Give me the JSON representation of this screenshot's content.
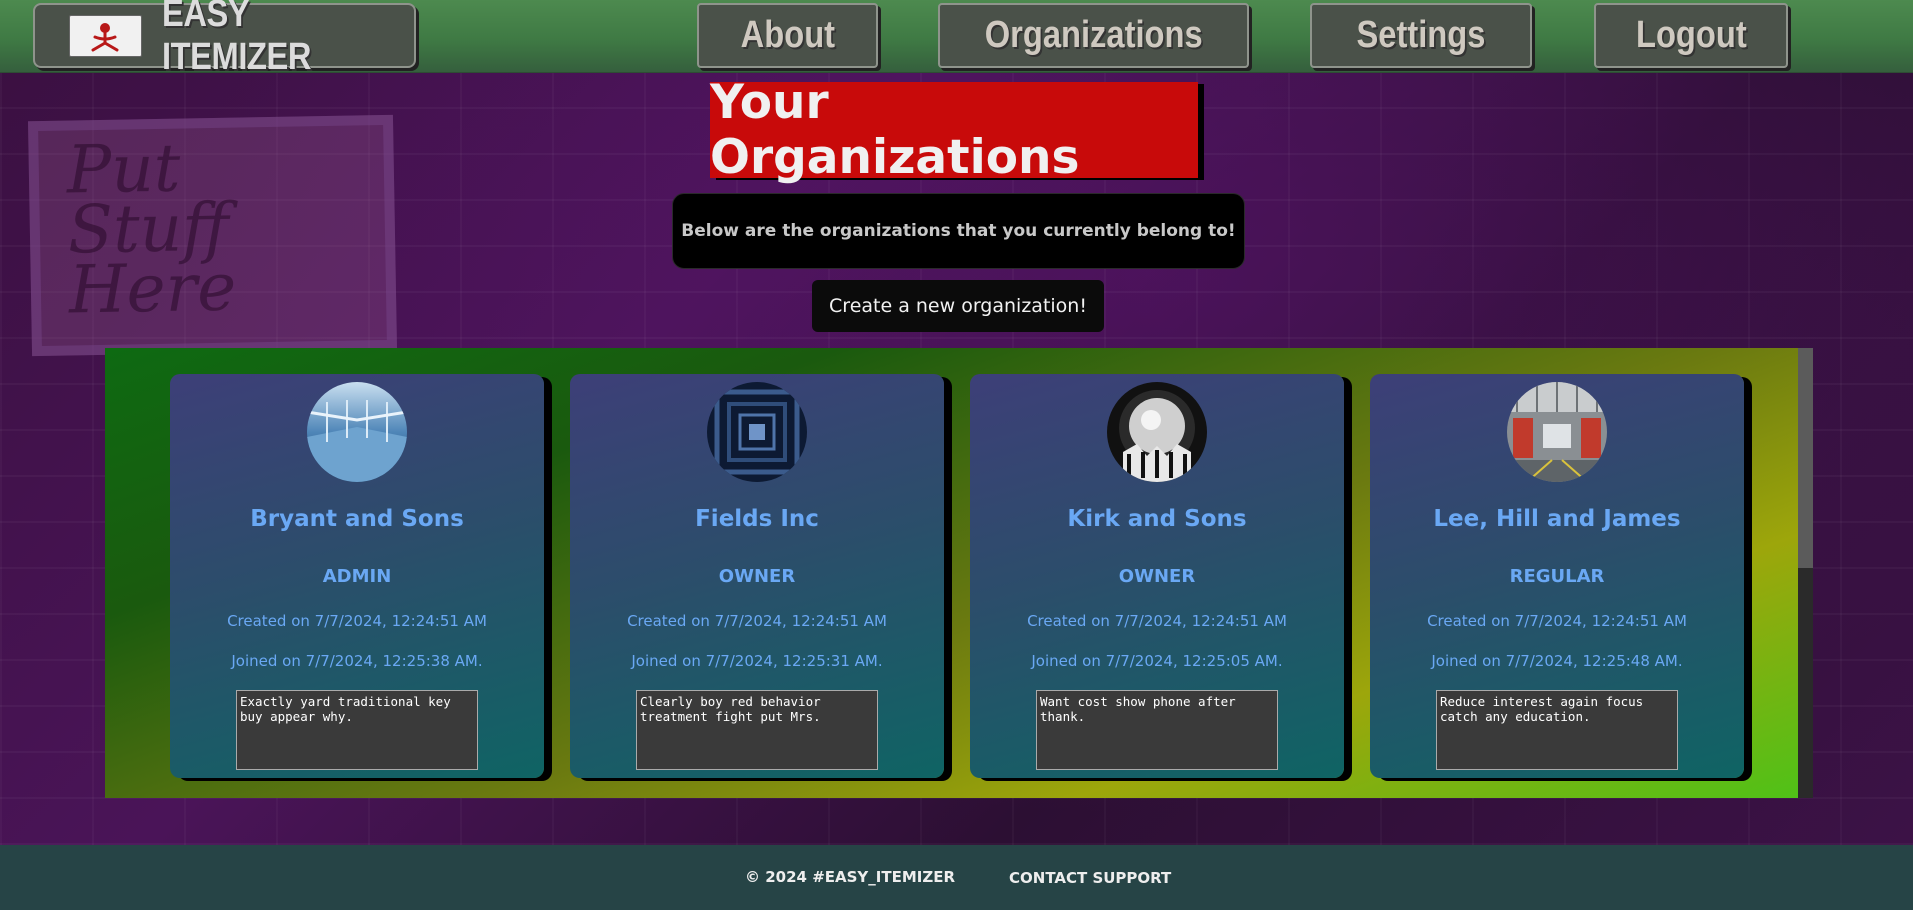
{
  "header": {
    "brand_name": "EASY ITEMIZER",
    "nav": [
      {
        "label": "About"
      },
      {
        "label": "Organizations"
      },
      {
        "label": "Settings"
      },
      {
        "label": "Logout"
      }
    ]
  },
  "background": {
    "sign_text": "Put Stuff Here"
  },
  "main": {
    "title": "Your Organizations",
    "subtitle": "Below are the organizations that you currently belong to!",
    "create_button": "Create a new organization!"
  },
  "organizations": [
    {
      "name": "Bryant and Sons",
      "role": "ADMIN",
      "created": "Created on 7/7/2024, 12:24:51 AM",
      "joined": "Joined on 7/7/2024, 12:25:38 AM.",
      "description": "Exactly yard traditional key buy appear why."
    },
    {
      "name": "Fields Inc",
      "role": "OWNER",
      "created": "Created on 7/7/2024, 12:24:51 AM",
      "joined": "Joined on 7/7/2024, 12:25:31 AM.",
      "description": "Clearly boy red behavior treatment fight put Mrs."
    },
    {
      "name": "Kirk and Sons",
      "role": "OWNER",
      "created": "Created on 7/7/2024, 12:24:51 AM",
      "joined": "Joined on 7/7/2024, 12:25:05 AM.",
      "description": "Want cost show phone after thank."
    },
    {
      "name": "Lee, Hill and James",
      "role": "REGULAR",
      "created": "Created on 7/7/2024, 12:24:51 AM",
      "joined": "Joined on 7/7/2024, 12:25:48 AM.",
      "description": "Reduce interest again focus catch any education."
    }
  ],
  "footer": {
    "copyright": "© 2024 #EASY_ITEMIZER",
    "support": "CONTACT SUPPORT"
  },
  "colors": {
    "title_bg": "#c80a0a",
    "accent_text": "#6aa8f4",
    "footer_bg": "#264446"
  }
}
